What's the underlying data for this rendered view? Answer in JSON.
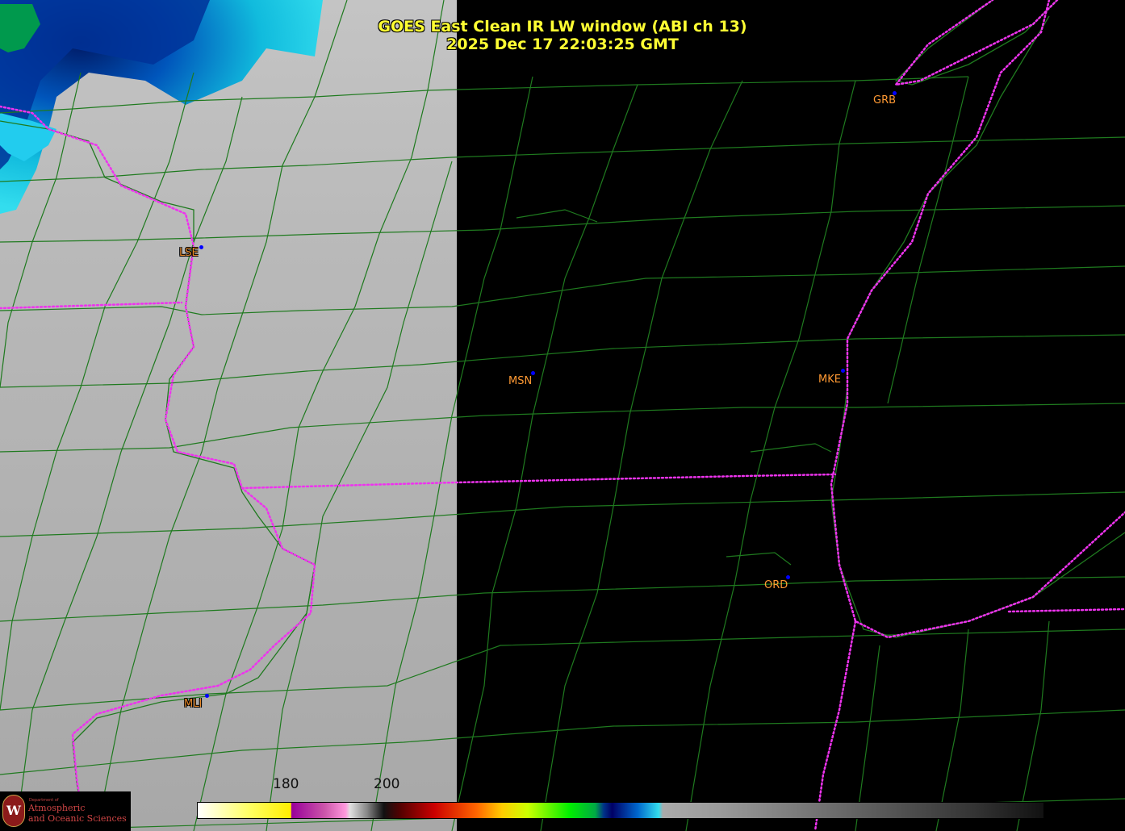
{
  "title": {
    "line1": "GOES East Clean IR LW window (ABI ch 13)",
    "line2": "2025 Dec 17  22:03:25 GMT"
  },
  "cities": [
    {
      "id": "LSE",
      "label": "LSE"
    },
    {
      "id": "MSN",
      "label": "MSN"
    },
    {
      "id": "MKE",
      "label": "MKE"
    },
    {
      "id": "GRB",
      "label": "GRB"
    },
    {
      "id": "ORD",
      "label": "ORD"
    },
    {
      "id": "MLI",
      "label": "MLI"
    }
  ],
  "colorbar": {
    "ticks": [
      "180",
      "200"
    ]
  },
  "logo": {
    "dept": "Department of",
    "line1": "Atmospheric",
    "line2": "and Oceanic Sciences",
    "seal_letter": "W"
  },
  "colors": {
    "county_lines": "#1f7a1f",
    "state_lines": "#ee33ee",
    "city_labels": "#ff9933",
    "station_dots": "#0000ff",
    "title_text": "#ffff33"
  }
}
